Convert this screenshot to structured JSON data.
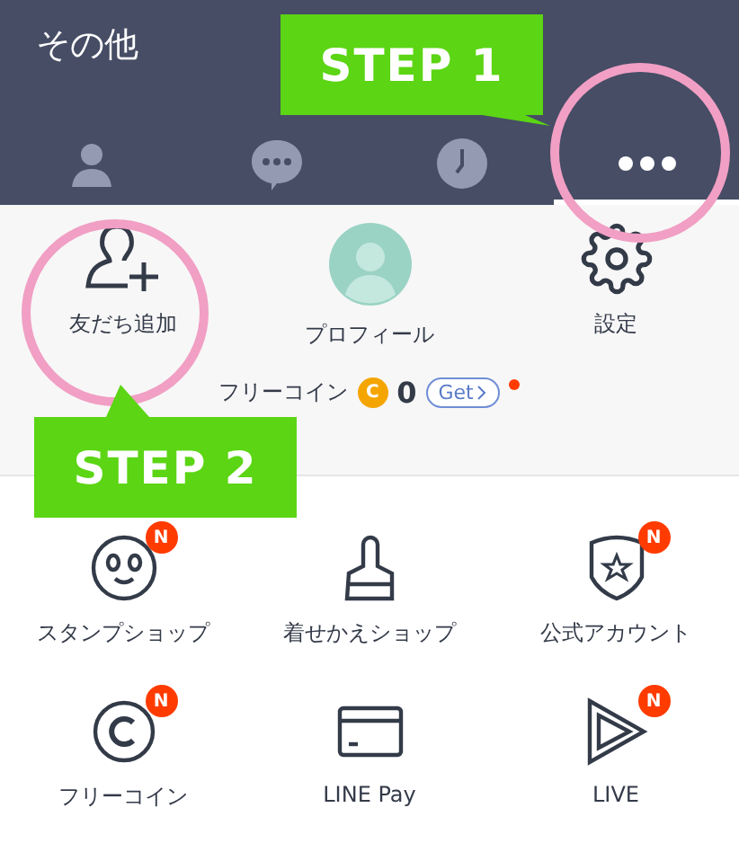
{
  "header": {
    "title": "その他"
  },
  "tabs": [
    {
      "kind": "person",
      "selected": false
    },
    {
      "kind": "chat",
      "selected": false
    },
    {
      "kind": "clock",
      "selected": false
    },
    {
      "kind": "more",
      "selected": true
    }
  ],
  "top_actions": [
    {
      "kind": "add-friend",
      "label": "友だち追加"
    },
    {
      "kind": "avatar",
      "label": "プロフィール"
    },
    {
      "kind": "gear",
      "label": "設定"
    }
  ],
  "free_coin": {
    "label": "フリーコイン",
    "coin": "C",
    "amount": "0",
    "button": "Get",
    "new_dot": true
  },
  "menu": [
    {
      "kind": "sticker",
      "label": "スタンプショップ",
      "badge": "N"
    },
    {
      "kind": "brush",
      "label": "着せかえショップ"
    },
    {
      "kind": "shield",
      "label": "公式アカウント",
      "badge": "N"
    },
    {
      "kind": "coin",
      "label": "フリーコイン",
      "badge": "N"
    },
    {
      "kind": "card",
      "label": "LINE Pay"
    },
    {
      "kind": "play",
      "label": "LIVE",
      "badge": "N"
    }
  ],
  "callouts": [
    {
      "text": "STEP 1"
    },
    {
      "text": "STEP 2"
    }
  ]
}
